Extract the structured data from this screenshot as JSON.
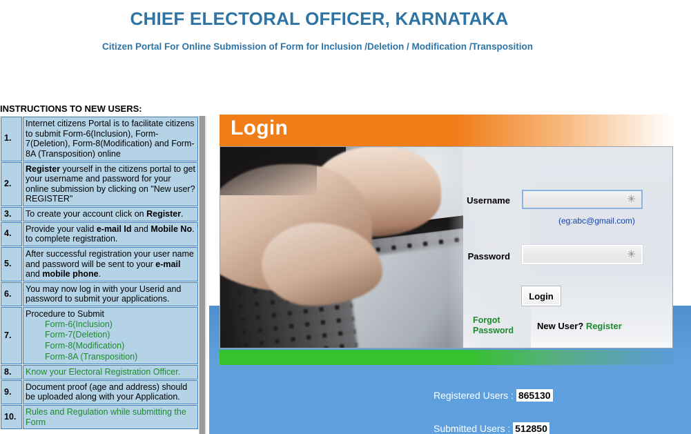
{
  "header": {
    "title": "CHIEF ELECTORAL OFFICER, KARNATAKA",
    "subtitle": "Citizen Portal For Online Submission of Form for Inclusion /Deletion / Modification /Transposition"
  },
  "instructions": {
    "heading": "INSTRUCTIONS TO NEW USERS:",
    "rows": [
      {
        "num": "1.",
        "text": "Internet citizens Portal is to facilitate citizens to submit Form-6(Inclusion), Form-7(Deletion), Form-8(Modification) and Form-8A (Transposition) online"
      },
      {
        "num": "2.",
        "lead": "Register",
        "text": " yourself in the citizens portal to get your username and password for your online submission by clicking on \"New user? REGISTER\""
      },
      {
        "num": "3.",
        "text": "To create your account click on ",
        "bold_tail": "Register",
        "tail": "."
      },
      {
        "num": "4.",
        "text": "Provide your valid ",
        "b1": "e-mail Id",
        "mid": " and ",
        "b2": "Mobile No",
        "tail": ". to complete registration."
      },
      {
        "num": "5.",
        "text": "After successful registration your user name and password will be sent to your ",
        "b1": "e-mail",
        "mid": " and ",
        "b2": "mobile phone",
        "tail": "."
      },
      {
        "num": "6.",
        "text": "You may now log in with your Userid and password to submit your applications."
      },
      {
        "num": "7.",
        "text": "Procedure to Submit",
        "links": [
          "Form-6(Inclusion)",
          "Form-7(Deletion)",
          "Form-8(Modification)",
          "Form-8A (Transposition)"
        ]
      },
      {
        "num": "8.",
        "link": "Know your Electoral Registration Officer."
      },
      {
        "num": "9.",
        "text": "Document proof (age and address) should be uploaded along with your Application."
      },
      {
        "num": "10.",
        "link": "Rules and Regulation while submitting the Form"
      }
    ]
  },
  "login": {
    "panel_title": "Login",
    "username_label": "Username",
    "username_value": "",
    "username_required_mark": "✳",
    "username_hint": "(eg:abc@gmail.com)",
    "password_label": "Password",
    "password_value": "",
    "password_required_mark": "✳",
    "login_button": "Login",
    "forgot_password": "Forgot Password",
    "new_user_prefix": "New User? ",
    "register_link": "Register"
  },
  "stats": {
    "registered_label": "Registered Users :",
    "registered_value": "865130",
    "submitted_label": "Submitted Users :",
    "submitted_value": "512850"
  },
  "colors": {
    "title_blue": "#2E74A5",
    "accent_orange": "#F07D18",
    "accent_green": "#36C12E",
    "link_green": "#1D8A2E",
    "panel_blue": "#5B9BD9",
    "cell_blue": "#B4D3E7",
    "cell_border": "#3D7EBB"
  }
}
